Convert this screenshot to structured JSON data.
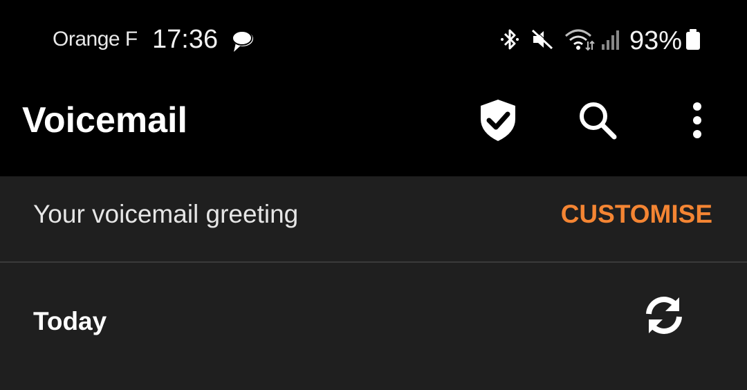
{
  "status_bar": {
    "carrier": "Orange F",
    "time": "17:36",
    "battery_percent": "93%",
    "icons": [
      "message-bubble-icon",
      "bluetooth-icon",
      "mute-icon",
      "wifi-icon",
      "signal-icon",
      "battery-icon"
    ]
  },
  "app_bar": {
    "title": "Voicemail",
    "actions": [
      "shield-check-icon",
      "search-icon",
      "more-vert-icon"
    ]
  },
  "greeting": {
    "label": "Your voicemail greeting",
    "action_label": "CUSTOMISE"
  },
  "section": {
    "label": "Today",
    "action_icon": "refresh-icon"
  },
  "colors": {
    "background": "#000000",
    "surface": "#1f1f1f",
    "accent": "#f48533",
    "divider": "#3a3a3a"
  }
}
